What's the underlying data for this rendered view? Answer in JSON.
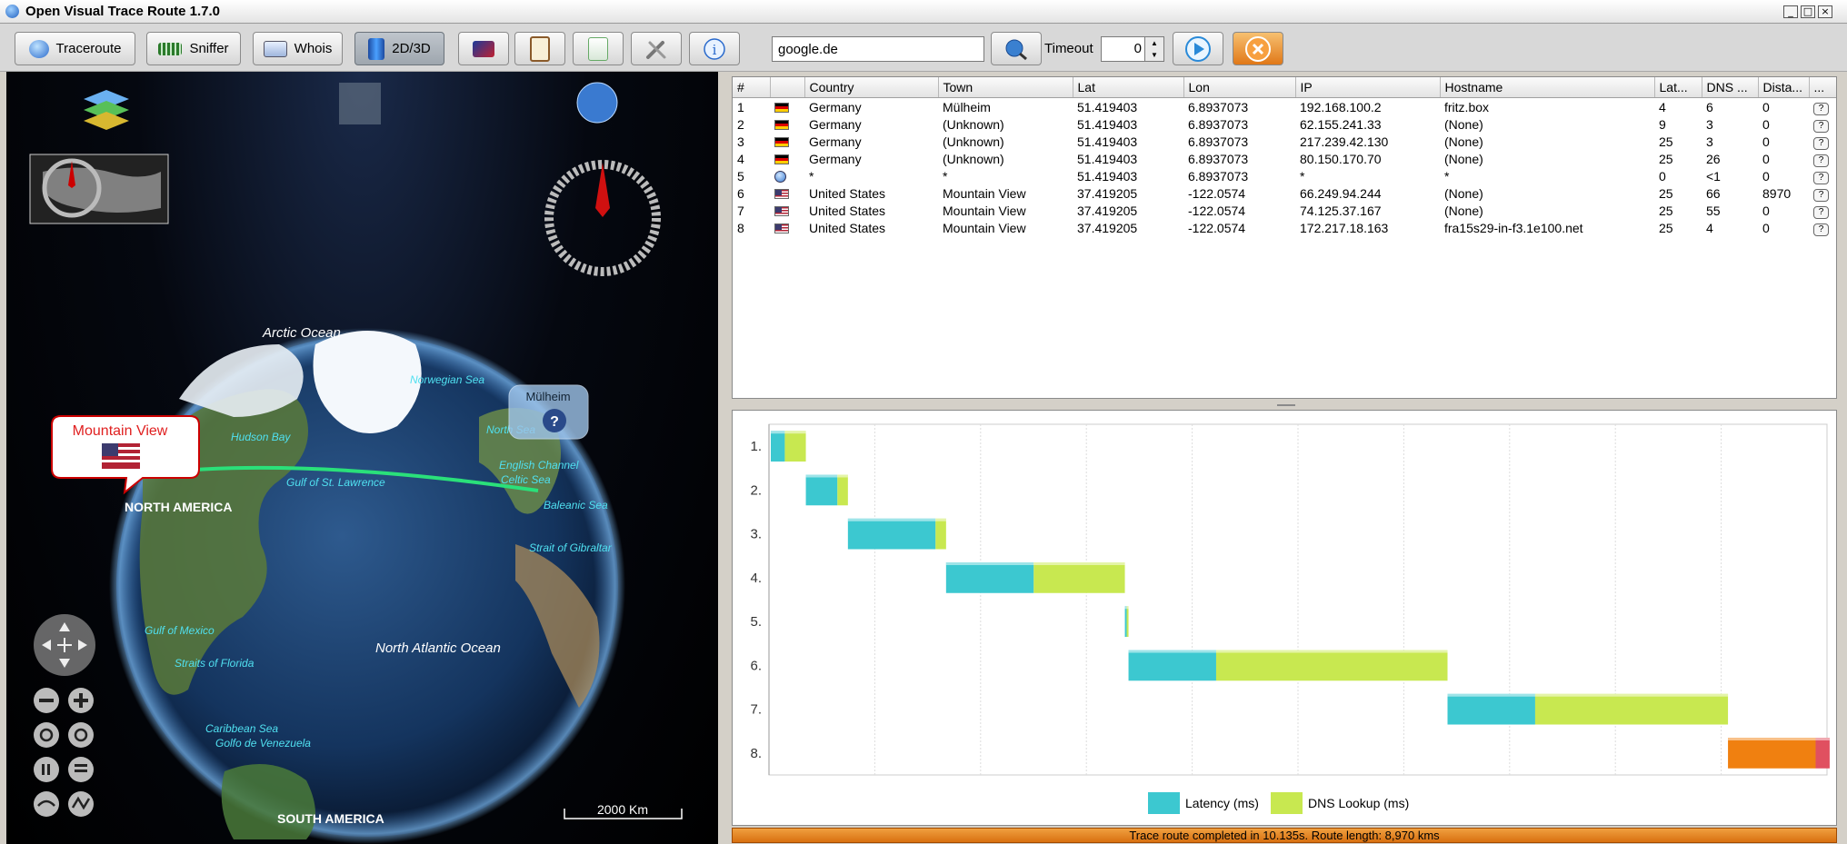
{
  "window": {
    "title": "Open Visual Trace Route 1.7.0",
    "controls": [
      "_",
      "□",
      "×"
    ]
  },
  "toolbar": {
    "traceroute_label": "Traceroute",
    "sniffer_label": "Sniffer",
    "whois_label": "Whois",
    "view_label": "2D/3D",
    "host_value": "google.de",
    "timeout_label": "Timeout",
    "timeout_value": "0"
  },
  "map": {
    "labels": {
      "arctic": "Arctic Ocean",
      "norwegian": "Norwegian Sea",
      "hudson": "Hudson Bay",
      "gulf_stl": "Gulf of St. Lawrence",
      "north_sea": "North Sea",
      "english_channel": "English Channel",
      "celtic": "Celtic Sea",
      "baleanic": "Baleanic Sea",
      "gibraltar": "Strait of Gibraltar",
      "north_america": "NORTH AMERICA",
      "north_atlantic": "North Atlantic Ocean",
      "gulf_mexico": "Gulf of Mexico",
      "florida": "Straits of Florida",
      "caribbean": "Caribbean Sea",
      "venezuela": "Golfo de Venezuela",
      "south_america": "SOUTH AMERICA"
    },
    "callout_mv": "Mountain View",
    "callout_mulheim": "Mülheim",
    "callout_mulheim_icon": "?",
    "scale_label": "2000 Km"
  },
  "table": {
    "columns": [
      "#",
      "",
      "Country",
      "Town",
      "Lat",
      "Lon",
      "IP",
      "Hostname",
      "Lat...",
      "DNS ...",
      "Dista...",
      "..."
    ],
    "rows": [
      {
        "n": "1",
        "flag": "de",
        "country": "Germany",
        "town": "Mülheim",
        "lat": "51.419403",
        "lon": "6.8937073",
        "ip": "192.168.100.2",
        "host": "fritz.box",
        "latency": "4",
        "dns": "6",
        "dist": "0"
      },
      {
        "n": "2",
        "flag": "de",
        "country": "Germany",
        "town": "(Unknown)",
        "lat": "51.419403",
        "lon": "6.8937073",
        "ip": "62.155.241.33",
        "host": "(None)",
        "latency": "9",
        "dns": "3",
        "dist": "0"
      },
      {
        "n": "3",
        "flag": "de",
        "country": "Germany",
        "town": "(Unknown)",
        "lat": "51.419403",
        "lon": "6.8937073",
        "ip": "217.239.42.130",
        "host": "(None)",
        "latency": "25",
        "dns": "3",
        "dist": "0"
      },
      {
        "n": "4",
        "flag": "de",
        "country": "Germany",
        "town": "(Unknown)",
        "lat": "51.419403",
        "lon": "6.8937073",
        "ip": "80.150.170.70",
        "host": "(None)",
        "latency": "25",
        "dns": "26",
        "dist": "0"
      },
      {
        "n": "5",
        "flag": "unk",
        "country": "*",
        "town": "*",
        "lat": "51.419403",
        "lon": "6.8937073",
        "ip": "*",
        "host": "*",
        "latency": "0",
        "dns": "<1",
        "dist": "0"
      },
      {
        "n": "6",
        "flag": "us",
        "country": "United States",
        "town": "Mountain View",
        "lat": "37.419205",
        "lon": "-122.0574",
        "ip": "66.249.94.244",
        "host": "(None)",
        "latency": "25",
        "dns": "66",
        "dist": "8970"
      },
      {
        "n": "7",
        "flag": "us",
        "country": "United States",
        "town": "Mountain View",
        "lat": "37.419205",
        "lon": "-122.0574",
        "ip": "74.125.37.167",
        "host": "(None)",
        "latency": "25",
        "dns": "55",
        "dist": "0"
      },
      {
        "n": "8",
        "flag": "us",
        "country": "United States",
        "town": "Mountain View",
        "lat": "37.419205",
        "lon": "-122.0574",
        "ip": "172.217.18.163",
        "host": "fra15s29-in-f3.1e100.net",
        "latency": "25",
        "dns": "4",
        "dist": "0"
      }
    ]
  },
  "chart_data": {
    "type": "bar",
    "categories": [
      "1.",
      "2.",
      "3.",
      "4.",
      "5.",
      "6.",
      "7.",
      "8."
    ],
    "series": [
      {
        "name": "Latency (ms)",
        "color": "#3cc8d0",
        "values": [
          4,
          9,
          25,
          25,
          0.3,
          25,
          25,
          25
        ]
      },
      {
        "name": "DNS Lookup (ms)",
        "color": "#c8e850",
        "values": [
          6,
          3,
          3,
          26,
          0.5,
          66,
          55,
          4
        ]
      }
    ],
    "last_hop_colors": [
      "#f08010",
      "#e05060"
    ],
    "legend_position": "bottom",
    "grid": true
  },
  "status": {
    "text": "Trace route completed in 10.135s. Route length: 8,970 kms"
  }
}
